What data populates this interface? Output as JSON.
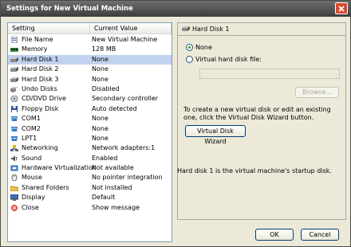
{
  "window": {
    "title": "Settings for New Virtual Machine"
  },
  "list": {
    "header_setting": "Setting",
    "header_value": "Current Value",
    "items": [
      {
        "name": "File Name",
        "value": "New Virtual Machine",
        "icon": "file-icon"
      },
      {
        "name": "Memory",
        "value": "128 MB",
        "icon": "memory-icon"
      },
      {
        "name": "Hard Disk 1",
        "value": "None",
        "icon": "hard-disk-icon"
      },
      {
        "name": "Hard Disk 2",
        "value": "None",
        "icon": "hard-disk-icon"
      },
      {
        "name": "Hard Disk 3",
        "value": "None",
        "icon": "hard-disk-icon"
      },
      {
        "name": "Undo Disks",
        "value": "Disabled",
        "icon": "undo-disks-icon"
      },
      {
        "name": "CD/DVD Drive",
        "value": "Secondary controller",
        "icon": "cd-icon"
      },
      {
        "name": "Floppy Disk",
        "value": "Auto detected",
        "icon": "floppy-icon"
      },
      {
        "name": "COM1",
        "value": "None",
        "icon": "com-port-icon"
      },
      {
        "name": "COM2",
        "value": "None",
        "icon": "com-port-icon"
      },
      {
        "name": "LPT1",
        "value": "None",
        "icon": "printer-port-icon"
      },
      {
        "name": "Networking",
        "value": "Network adapters:1",
        "icon": "network-icon"
      },
      {
        "name": "Sound",
        "value": "Enabled",
        "icon": "sound-icon"
      },
      {
        "name": "Hardware Virtualization",
        "value": "Not available",
        "icon": "hardware-virtualization-icon"
      },
      {
        "name": "Mouse",
        "value": "No pointer integration",
        "icon": "mouse-icon"
      },
      {
        "name": "Shared Folders",
        "value": "Not installed",
        "icon": "folder-icon"
      },
      {
        "name": "Display",
        "value": "Default",
        "icon": "display-icon"
      },
      {
        "name": "Close",
        "value": "Show message",
        "icon": "close-setting-icon"
      }
    ],
    "selected_index": 2
  },
  "detail": {
    "title": "Hard Disk 1",
    "radio_none": "None",
    "radio_vhd": "Virtual hard disk file:",
    "selected_option": "None",
    "vhd_path": "",
    "browse_label": "Browse...",
    "description": "To create a new virtual disk or edit an existing one, click the Virtual Disk Wizard button.",
    "wizard_label": "Virtual Disk Wizard",
    "startup_note": "Hard disk 1 is the virtual machine's startup disk."
  },
  "buttons": {
    "ok": "OK",
    "cancel": "Cancel"
  },
  "colors": {
    "selection": "#c1d2ee",
    "dialog_bg": "#ece9d8",
    "title_bar": "#4a4a4a"
  }
}
